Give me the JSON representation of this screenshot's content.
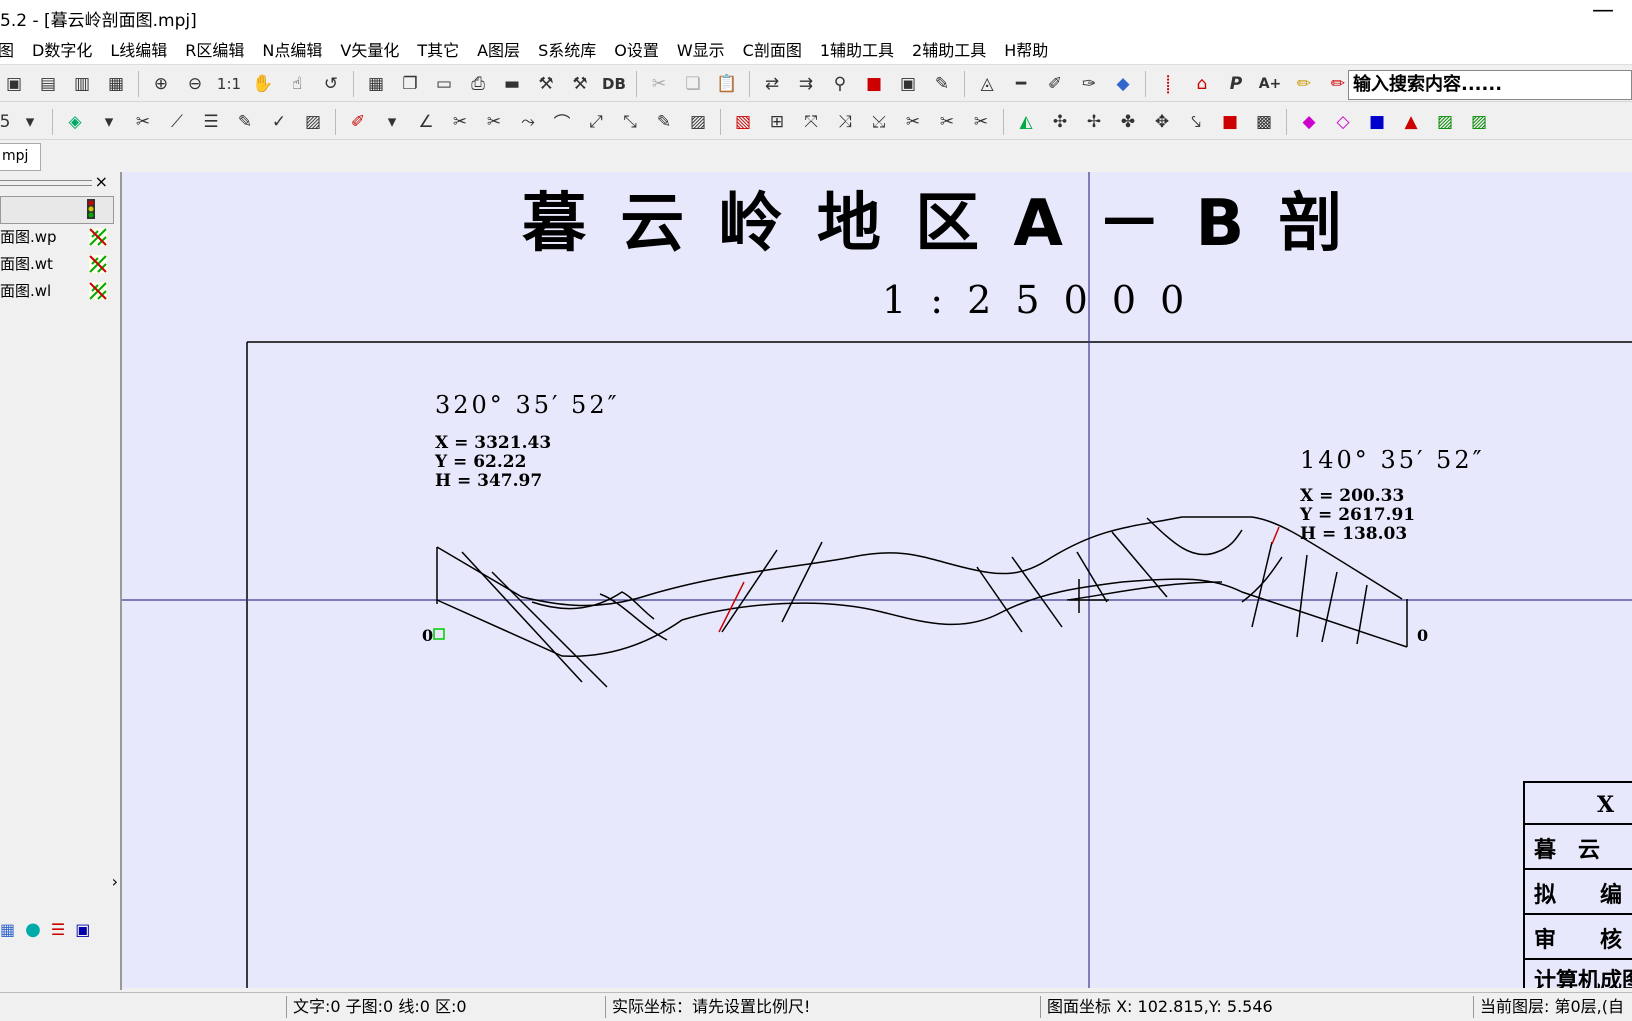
{
  "window": {
    "title": "5.2 - [暮云岭剖面图.mpj]",
    "minimize": "—"
  },
  "menu": [
    "图",
    "D数字化",
    "L线编辑",
    "R区编辑",
    "N点编辑",
    "V矢量化",
    "T其它",
    "A图层",
    "S系统库",
    "O设置",
    "W显示",
    "C剖面图",
    "1辅助工具",
    "2辅助工具",
    "H帮助"
  ],
  "toolbar": {
    "search_text": "输入搜索内容......",
    "zoom_label": "1:1",
    "db_label": "DB",
    "font_label": "P",
    "aplus_label": "A+",
    "left_combo": "5"
  },
  "doc_tab": "mpj",
  "left_panel": {
    "close": "×",
    "files": [
      "面图.wp",
      "面图.wt",
      "面图.wl"
    ],
    "scroll_arrow": "›"
  },
  "map": {
    "title": "暮 云 岭 地 区 A － B 剖",
    "scale": "1 : 2 5 0 0 0",
    "left_bearing": "320° 35′ 52″",
    "left_coords": [
      "X = 3321.43",
      "Y = 62.22",
      "H = 347.97"
    ],
    "right_bearing": "140° 35′ 52″",
    "right_coords": [
      "X = 200.33",
      "Y = 2617.91",
      "H = 138.03"
    ],
    "left_zero": "0",
    "right_zero": "0",
    "legend_cells": [
      "X",
      "暮　云",
      "拟　　编",
      "审　　核",
      "计算机成图"
    ]
  },
  "status": {
    "counts": "文字:0 子图:0 线:0 区:0",
    "real_coord": "实际坐标：请先设置比例尺!",
    "map_coord": "图面坐标 X: 102.815,Y:  5.546",
    "layer": "当前图层: 第0层,(自"
  }
}
